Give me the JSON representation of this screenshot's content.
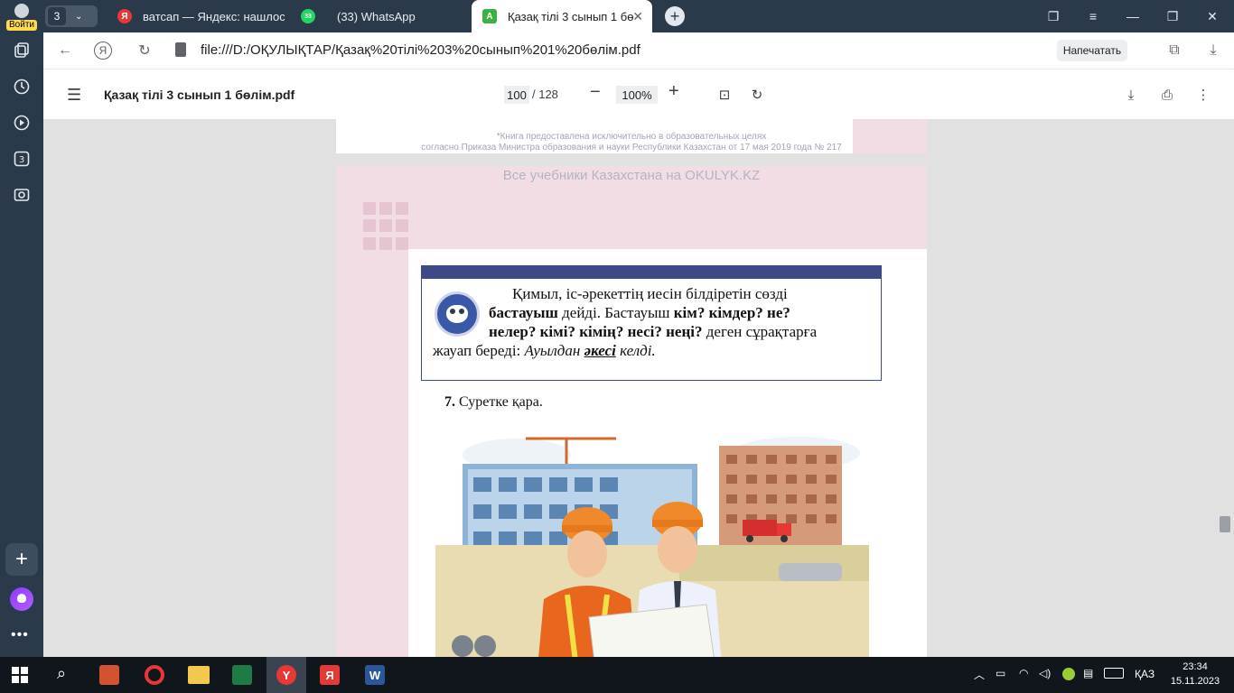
{
  "sidebar": {
    "login_label": "Войти",
    "tab_count": "3"
  },
  "tabs": [
    {
      "label": "ватсап — Яндекс: нашлось",
      "favicon": "Я"
    },
    {
      "label": "(33) WhatsApp",
      "favicon": "33"
    },
    {
      "label": "Қазақ тілі 3 сынып 1 бө",
      "favicon": "A"
    }
  ],
  "addressbar": {
    "url": "file:///D:/ОҚУЛЫҚТАР/Қазақ%20тілі%203%20сынып%201%20бөлім.pdf",
    "print_label": "Напечатать"
  },
  "pdf_toolbar": {
    "title": "Қазақ тілі 3 сынып 1 бөлім.pdf",
    "current_page": "100",
    "total_pages": "/ 128",
    "zoom": "100%"
  },
  "page_prev": {
    "disclaimer_line1": "*Книга предоставлена исключительно в образовательных целях",
    "disclaimer_line2": "согласно Приказа Министра образования и науки Республики Казахстан от 17 мая 2019 года № 217"
  },
  "page_current": {
    "watermark": "Все учебники Казахстана на OKULYK.KZ",
    "rule": {
      "p1": "Қимыл, іс-әрекеттің иесін білдіретін сөзді",
      "p2_bold": "бастауыш",
      "p2_rest": " дейді. Бастауыш ",
      "p2_q": "кім? кімдер? не?",
      "p3_q": "нелер? кімі? кімің? несі? неңі?",
      "p3_rest": " деген сұрақтарға",
      "p4": "жауап береді: ",
      "p4_example_a": "Ауылдан ",
      "p4_example_b": "әкесі",
      "p4_example_c": " келді."
    },
    "exercise_number": "7.",
    "exercise_text": " Суретке қара."
  },
  "taskbar": {
    "time": "23:34",
    "date": "15.11.2023",
    "lang": "ҚАЗ"
  }
}
